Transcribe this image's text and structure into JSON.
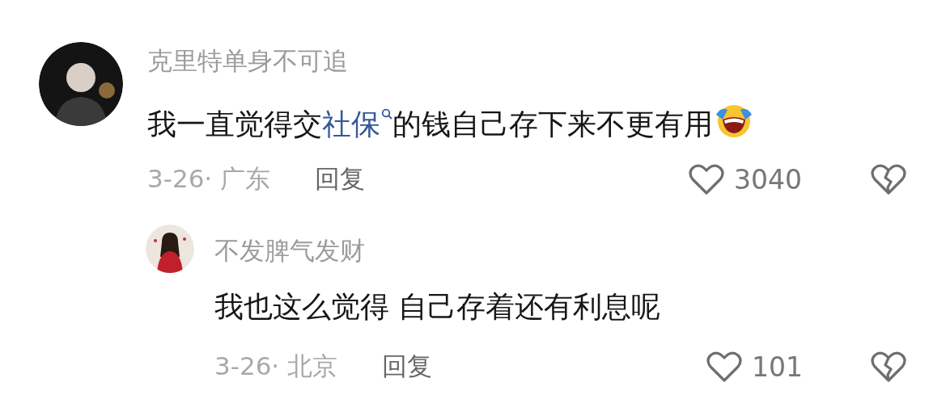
{
  "comments": [
    {
      "author": "克里特单身不可追",
      "text": [
        {
          "kind": "plain",
          "text": "我一直觉得交"
        },
        {
          "kind": "search-link",
          "text": "社保"
        },
        {
          "kind": "plain",
          "text": "的钱自己存下来不更有用"
        },
        {
          "kind": "emoji"
        }
      ],
      "date_location": "3-26· 广东",
      "reply_label": "回复",
      "likes": "3040",
      "replies": [
        {
          "author": "不发脾气发财",
          "text": [
            {
              "kind": "plain",
              "text": "我也这么觉得 自己存着还有利息呢"
            }
          ],
          "date_location": "3-26· 北京",
          "reply_label": "回复",
          "likes": "101"
        }
      ]
    }
  ]
}
